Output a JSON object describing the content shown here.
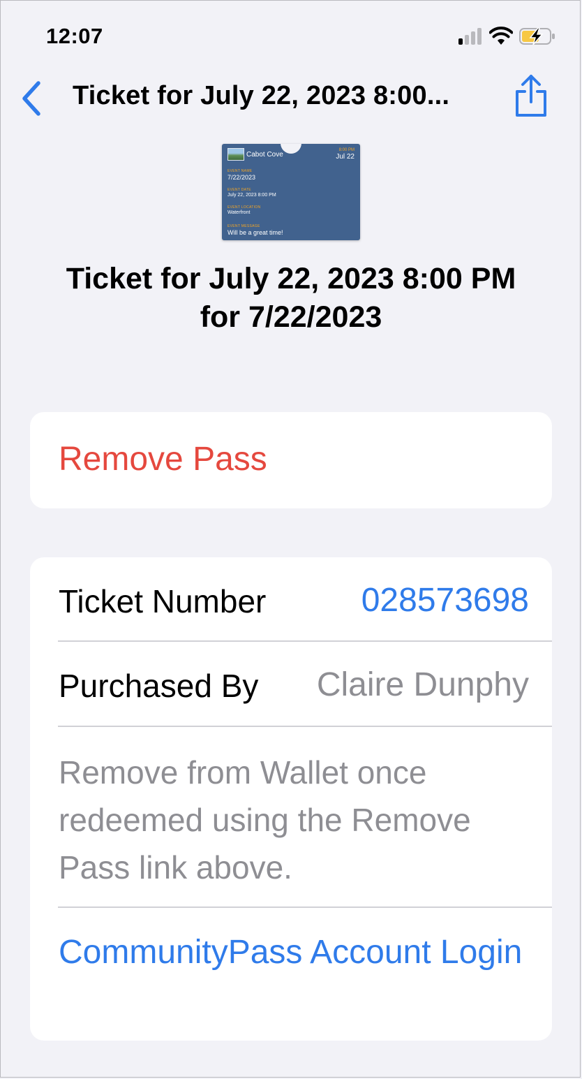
{
  "status_bar": {
    "time": "12:07",
    "icons": [
      "cellular-signal-icon",
      "wifi-icon",
      "battery-charging-icon"
    ]
  },
  "nav": {
    "title": "Ticket for July 22, 2023 8:00...",
    "back_icon": "chevron-left-icon",
    "share_icon": "share-icon"
  },
  "pass": {
    "organization": "Cabot Cove",
    "time_label": "8:00 PM",
    "date_short": "Jul 22",
    "fields": [
      {
        "label": "EVENT NAME",
        "value": "7/22/2023"
      },
      {
        "label": "EVENT DATE",
        "value": "July 22, 2023 8:00 PM"
      },
      {
        "label": "EVENT LOCATION",
        "value": "Waterfront"
      },
      {
        "label": "EVENT MESSAGE",
        "value": "Will be a great time!"
      }
    ]
  },
  "title": {
    "line1": "Ticket for July 22, 2023 8:00 PM",
    "line2": "for 7/22/2023"
  },
  "actions": {
    "remove_pass": "Remove Pass"
  },
  "details": {
    "ticket_number_label": "Ticket Number",
    "ticket_number_value": "028573698",
    "purchased_by_label": "Purchased By",
    "purchased_by_value": "Claire Dunphy",
    "note": "Remove from Wallet once redeemed using the Remove Pass link above.",
    "account_link": "CommunityPass Account Login"
  },
  "colors": {
    "background": "#f2f2f7",
    "accent_blue": "#2f7bea",
    "destructive_red": "#e5483e",
    "secondary_gray": "#8e8e93",
    "pass_background": "#41628e",
    "pass_label": "#f5a623"
  }
}
